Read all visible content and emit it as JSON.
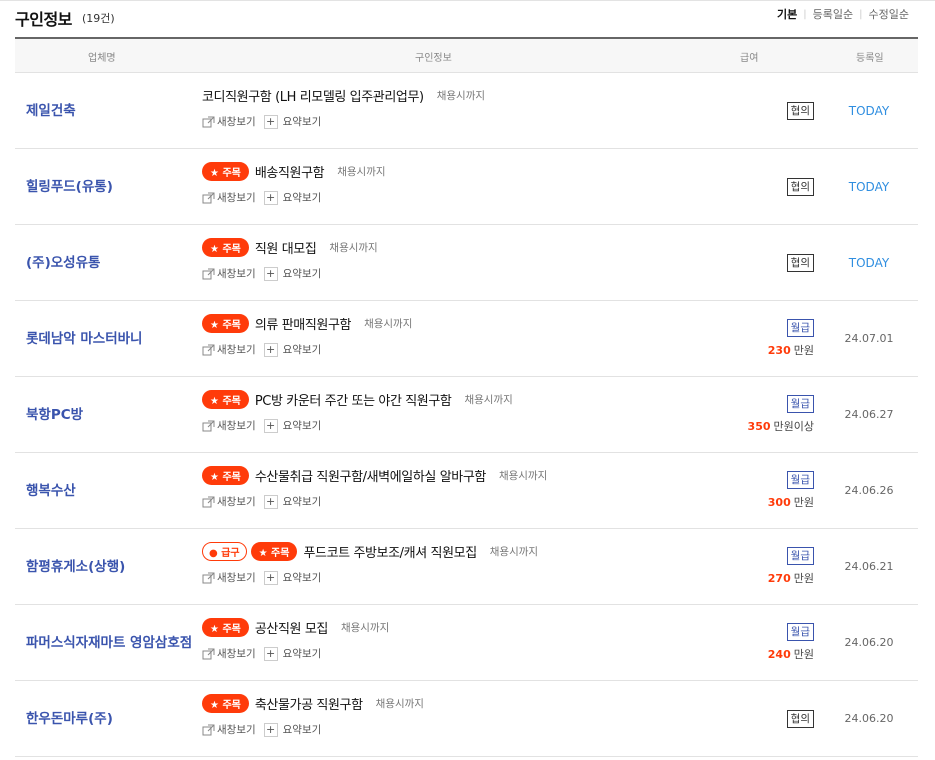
{
  "header": {
    "title": "구인정보",
    "count": "(19건)",
    "sort": [
      "기본",
      "등록일순",
      "수정일순"
    ]
  },
  "columns": {
    "company": "업체명",
    "info": "구인정보",
    "pay": "급여",
    "date": "등록일"
  },
  "labels": {
    "star": "★ 주목",
    "urgent": "● 급구",
    "new_window": "새창보기",
    "summary": "요약보기"
  },
  "colors": {
    "accent": "#ff3b0a",
    "company_link": "#3a54ad",
    "today": "#2f8ee0"
  },
  "icons": {
    "new_window": "external-link-icon",
    "summary": "plus-icon"
  },
  "listings": [
    {
      "company": "제일건축",
      "title": "코디직원구함 (LH 리모델링 입주관리업무)",
      "until": "채용시까지",
      "star": false,
      "urgent": false,
      "pay_type": "협의",
      "amount": "",
      "unit": "",
      "date": "TODAY"
    },
    {
      "company": "힐링푸드(유통)",
      "title": "배송직원구함",
      "until": "채용시까지",
      "star": true,
      "urgent": false,
      "pay_type": "협의",
      "amount": "",
      "unit": "",
      "date": "TODAY"
    },
    {
      "company": "(주)오성유통",
      "title": "직원 대모집",
      "until": "채용시까지",
      "star": true,
      "urgent": false,
      "pay_type": "협의",
      "amount": "",
      "unit": "",
      "date": "TODAY"
    },
    {
      "company": "롯데남악 마스터바니",
      "title": "의류 판매직원구함",
      "until": "채용시까지",
      "star": true,
      "urgent": false,
      "pay_type": "월급",
      "amount": "230",
      "unit": "만원",
      "date": "24.07.01"
    },
    {
      "company": "북항PC방",
      "title": "PC방 카운터 주간 또는 야간 직원구함",
      "until": "채용시까지",
      "star": true,
      "urgent": false,
      "pay_type": "월급",
      "amount": "350",
      "unit": "만원이상",
      "date": "24.06.27"
    },
    {
      "company": "행복수산",
      "title": "수산물취급 직원구함/새벽에일하실 알바구함",
      "until": "채용시까지",
      "star": true,
      "urgent": false,
      "pay_type": "월급",
      "amount": "300",
      "unit": "만원",
      "date": "24.06.26"
    },
    {
      "company": "함평휴게소(상행)",
      "title": "푸드코트 주방보조/캐셔 직원모집",
      "until": "채용시까지",
      "star": true,
      "urgent": true,
      "pay_type": "월급",
      "amount": "270",
      "unit": "만원",
      "date": "24.06.21"
    },
    {
      "company": "파머스식자재마트 영암삼호점",
      "title": "공산직원 모집",
      "until": "채용시까지",
      "star": true,
      "urgent": false,
      "pay_type": "월급",
      "amount": "240",
      "unit": "만원",
      "date": "24.06.20"
    },
    {
      "company": "한우돈마루(주)",
      "title": "축산물가공 직원구함",
      "until": "채용시까지",
      "star": true,
      "urgent": false,
      "pay_type": "협의",
      "amount": "",
      "unit": "",
      "date": "24.06.20"
    }
  ]
}
